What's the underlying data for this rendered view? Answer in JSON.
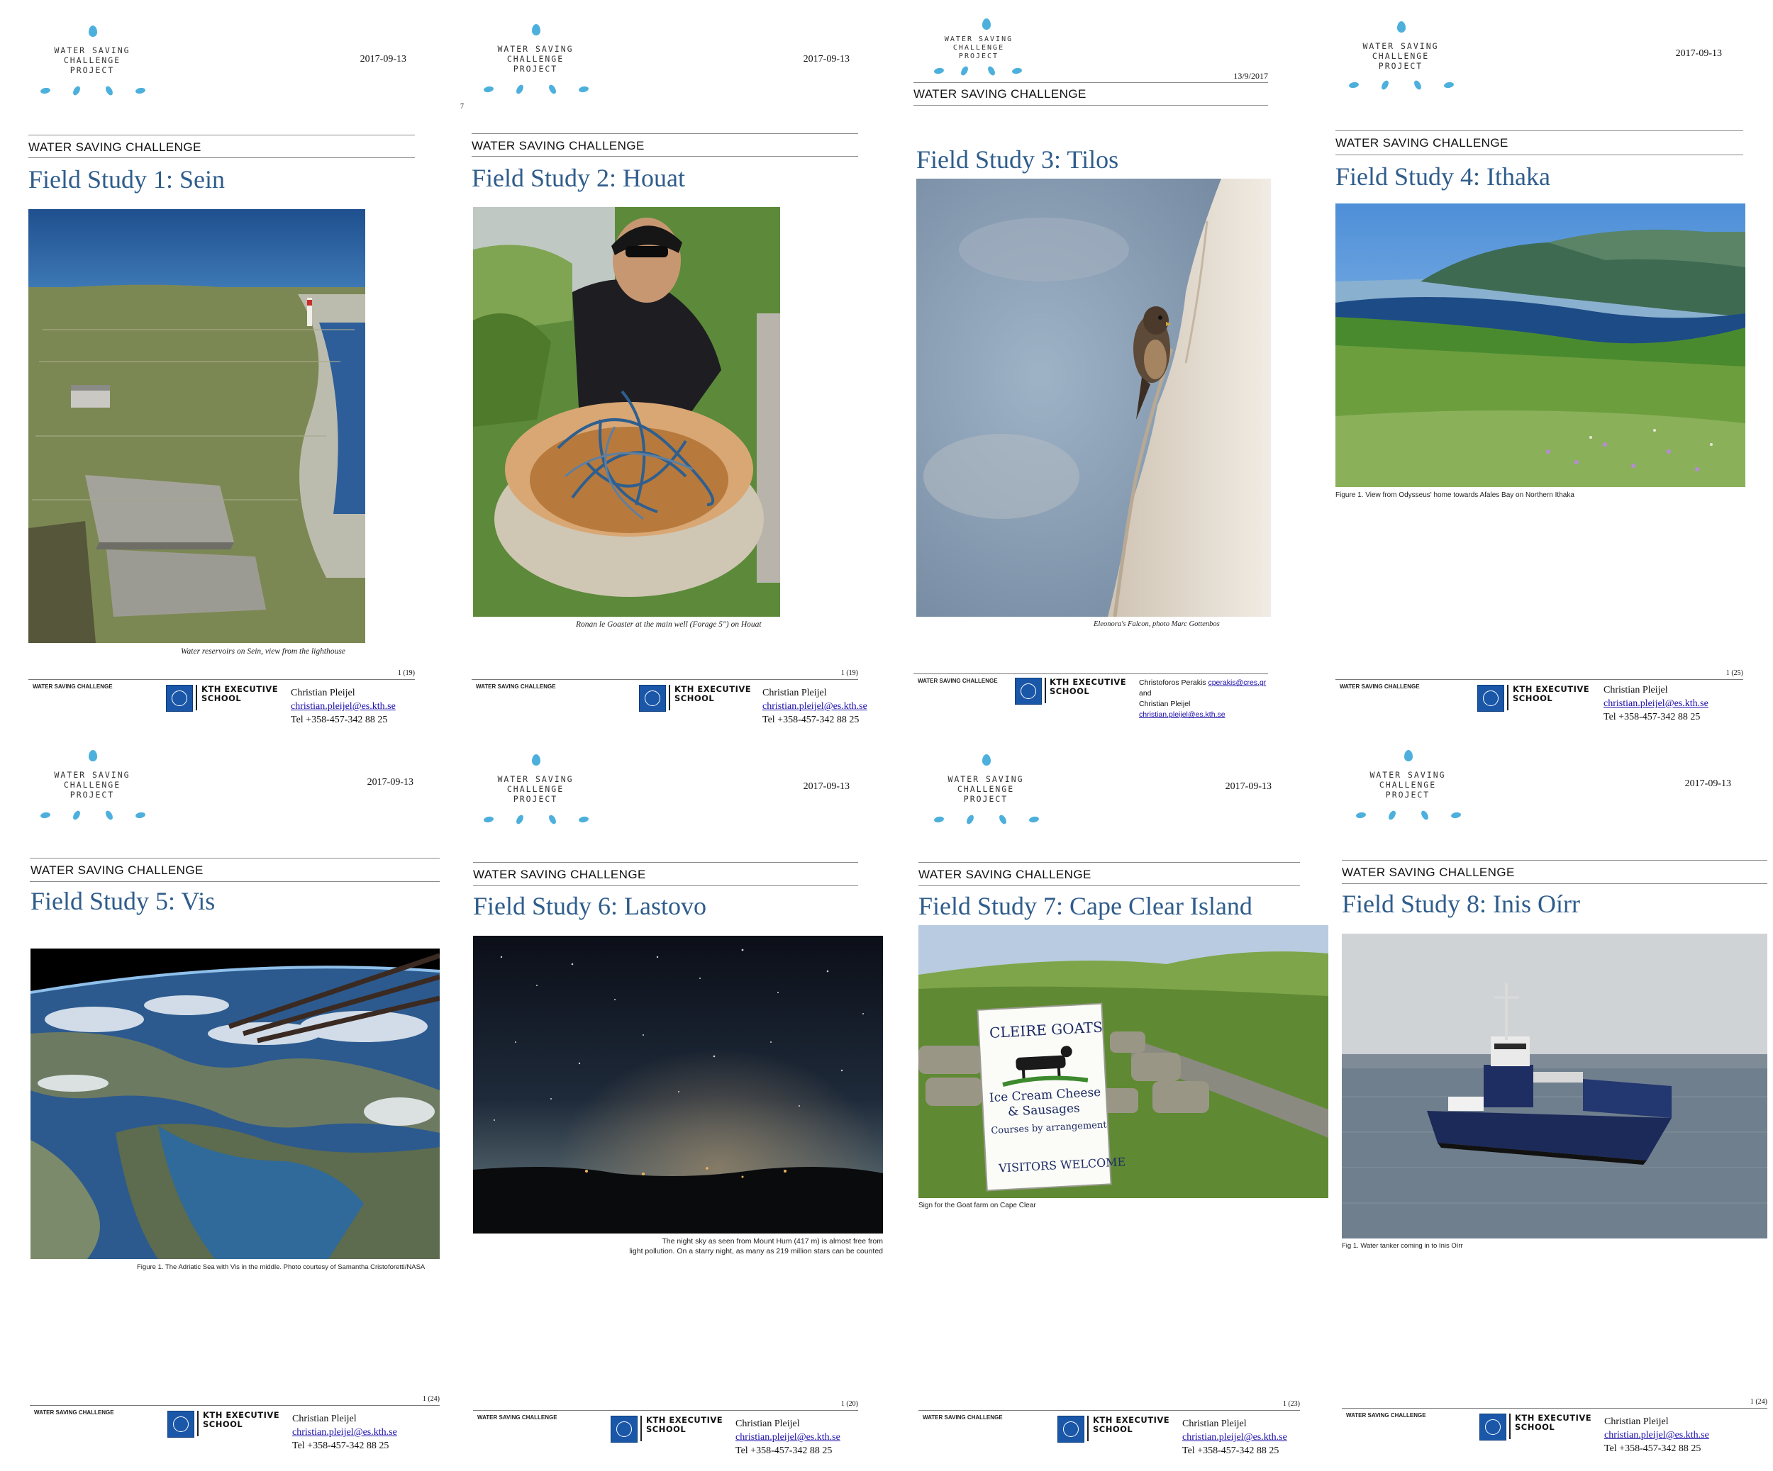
{
  "common": {
    "logo_lines": [
      "WATER SAVING",
      "CHALLENGE",
      "PROJECT"
    ],
    "section_title": "WATER SAVING CHALLENGE",
    "footer_left": "WATER SAVING CHALLENGE",
    "kth_line1": "KTH EXECUTIVE",
    "kth_line2": "SCHOOL",
    "contact_name": "Christian Pleijel",
    "contact_email": "christian.pleijel@es.kth.se",
    "contact_phone": "Tel +358-457-342 88 25",
    "accent_color": "#2f5d8c",
    "logo_color": "#4db0dc"
  },
  "pages": [
    {
      "date": "2017-09-13",
      "title": "Field Study 1: Sein",
      "caption": "Water reservoirs on Sein, view from the lighthouse",
      "page": "1 (19)"
    },
    {
      "date": "2017-09-13",
      "page_marker": "7",
      "title": "Field Study 2: Houat",
      "caption": "Ronan le Goaster at the main well (Forage 5\") on Houat",
      "page": "1 (19)"
    },
    {
      "date": "13/9/2017",
      "title": "Field Study 3: Tilos",
      "caption": "Eleonora's Falcon, photo Marc Gottenbos",
      "contact_line1": "Christoforos Perakis",
      "contact_email2": "cperakis@cres.gr",
      "contact_and": "and",
      "contact_line2": "Christian Pleijel"
    },
    {
      "date": "2017-09-13",
      "title": "Field Study 4: Ithaka",
      "caption": "Figure 1. View from Odysseus' home towards Afales Bay on Northern Ithaka",
      "page": "1 (25)"
    },
    {
      "date": "2017-09-13",
      "title": "Field Study 5: Vis",
      "caption": "Figure 1. The Adriatic Sea with Vis in the middle. Photo courtesy of Samantha Cristoforetti/NASA",
      "page": "1 (24)"
    },
    {
      "date": "2017-09-13",
      "title": "Field Study 6: Lastovo",
      "caption_lines": [
        "The night sky as seen from Mount Hum (417 m) is almost free from",
        "light pollution. On a starry night, as many as 219 million stars can be counted"
      ],
      "page": "1 (20)"
    },
    {
      "date": "2017-09-13",
      "title": "Field Study 7: Cape Clear Island",
      "caption": "Sign for the Goat farm on Cape Clear",
      "page": "1 (23)",
      "sign_lines": [
        "CLEIRE GOATS",
        "Ice Cream Cheese",
        "& Sausages",
        "Courses by arrangement",
        "VISITORS WELCOME"
      ]
    },
    {
      "date": "2017-09-13",
      "title": "Field Study 8: Inis Oírr",
      "caption": "Fig 1. Water tanker coming in to Inis Oírr",
      "page": "1 (24)"
    }
  ]
}
